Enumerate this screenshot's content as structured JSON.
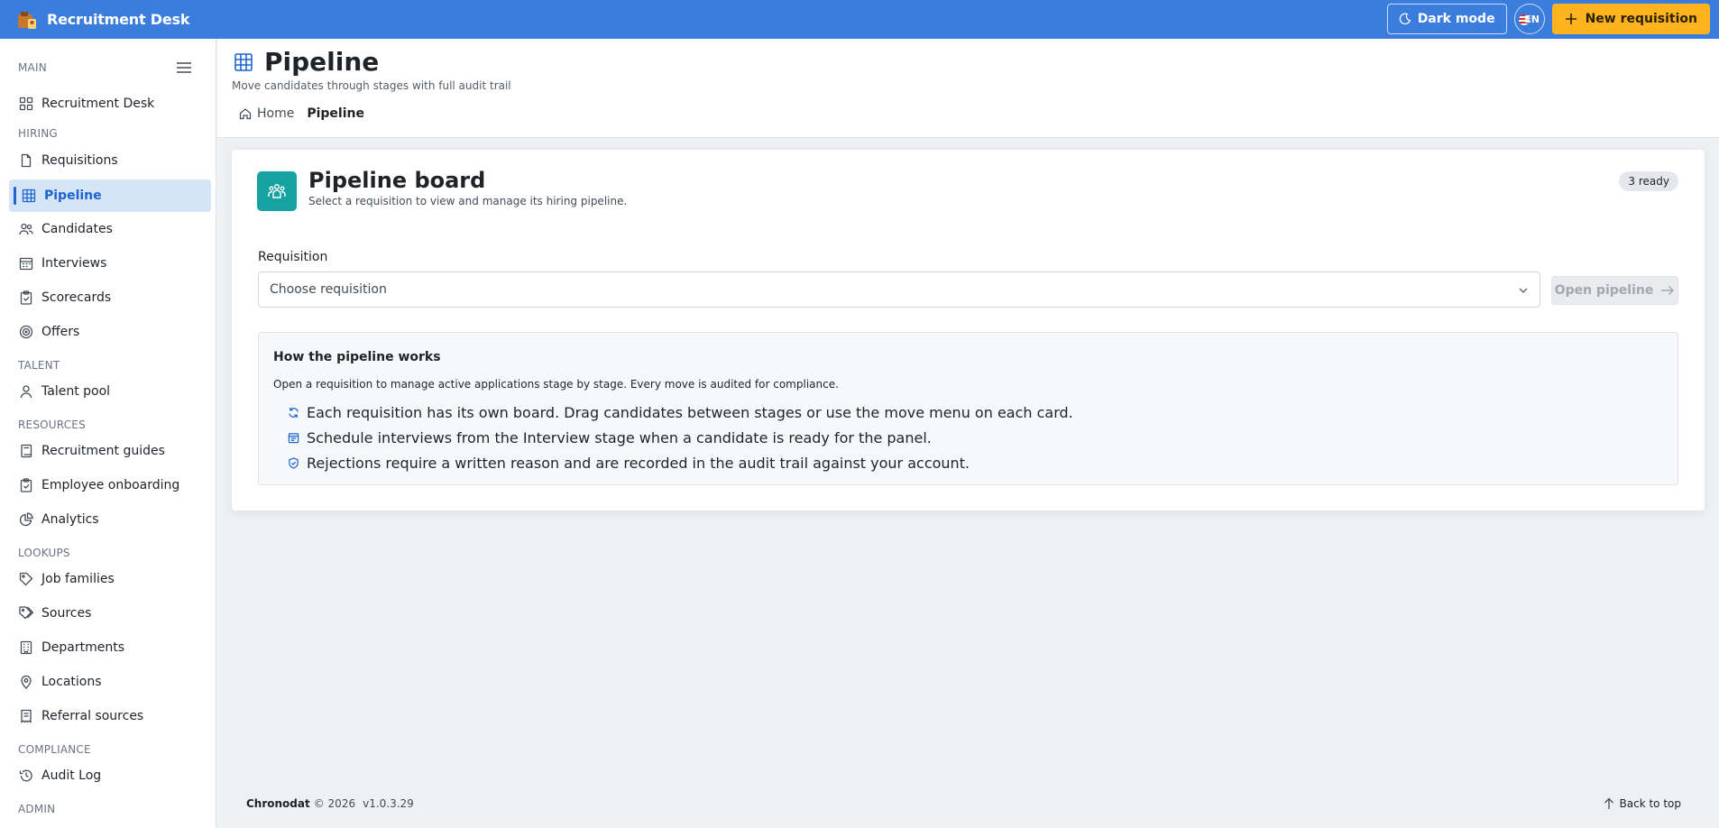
{
  "app": {
    "title": "Recruitment Desk",
    "dark_mode_label": "Dark mode",
    "language": "EN",
    "new_requisition_label": "New requisition"
  },
  "sidebar": {
    "sections": [
      {
        "label": "MAIN",
        "items": [
          {
            "label": "Recruitment Desk",
            "icon": "dashboard-icon"
          }
        ]
      },
      {
        "label": "HIRING",
        "items": [
          {
            "label": "Requisitions",
            "icon": "document-icon"
          },
          {
            "label": "Pipeline",
            "icon": "grid-icon",
            "active": true
          },
          {
            "label": "Candidates",
            "icon": "people-icon"
          },
          {
            "label": "Interviews",
            "icon": "calendar-icon"
          },
          {
            "label": "Scorecards",
            "icon": "clipboard-check-icon"
          },
          {
            "label": "Offers",
            "icon": "target-icon"
          }
        ]
      },
      {
        "label": "TALENT",
        "items": [
          {
            "label": "Talent pool",
            "icon": "person-icon"
          }
        ]
      },
      {
        "label": "RESOURCES",
        "items": [
          {
            "label": "Recruitment guides",
            "icon": "book-icon"
          },
          {
            "label": "Employee onboarding",
            "icon": "clipboard-icon"
          },
          {
            "label": "Analytics",
            "icon": "chart-pie-icon"
          }
        ]
      },
      {
        "label": "LOOKUPS",
        "items": [
          {
            "label": "Job families",
            "icon": "tag-icon"
          },
          {
            "label": "Sources",
            "icon": "tags-icon"
          },
          {
            "label": "Departments",
            "icon": "building-icon"
          },
          {
            "label": "Locations",
            "icon": "location-pin-icon"
          },
          {
            "label": "Referral sources",
            "icon": "receipt-icon"
          }
        ]
      },
      {
        "label": "COMPLIANCE",
        "items": [
          {
            "label": "Audit Log",
            "icon": "history-icon"
          }
        ]
      },
      {
        "label": "ADMIN",
        "items": []
      }
    ]
  },
  "page": {
    "title": "Pipeline",
    "subtitle": "Move candidates through stages with full audit trail",
    "breadcrumb": {
      "home": "Home",
      "current": "Pipeline"
    }
  },
  "card": {
    "title": "Pipeline board",
    "subtitle": "Select a requisition to view and manage its hiring pipeline.",
    "badge": "3 ready",
    "requisition_label": "Requisition",
    "requisition_placeholder": "Choose requisition",
    "open_button": "Open pipeline",
    "how": {
      "title": "How the pipeline works",
      "intro": "Open a requisition to manage active applications stage by stage. Every move is audited for compliance.",
      "items": [
        "Each requisition has its own board. Drag candidates between stages or use the move menu on each card.",
        "Schedule interviews from the Interview stage when a candidate is ready for the panel.",
        "Rejections require a written reason and are recorded in the audit trail against your account."
      ]
    }
  },
  "footer": {
    "brand": "Chronodat",
    "copyright": "© 2026",
    "version": "v1.0.3.29",
    "back_to_top": "Back to top"
  }
}
